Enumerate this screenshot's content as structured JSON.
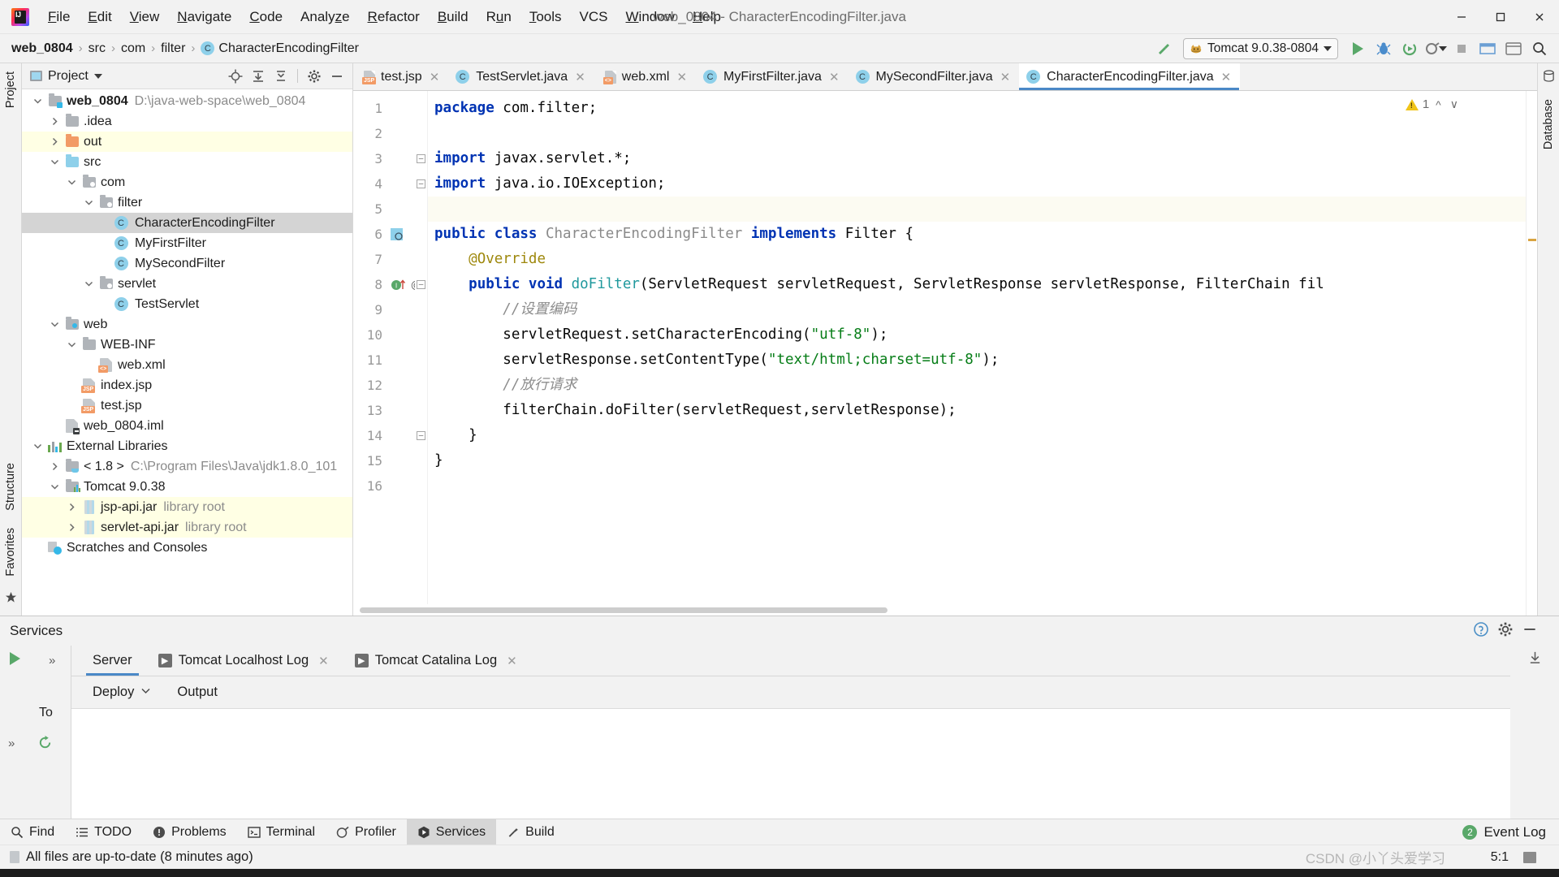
{
  "window": {
    "title": "web_0804 - CharacterEncodingFilter.java",
    "minimize": "─",
    "maximize": "☐",
    "close": "✕"
  },
  "menubar": {
    "items": [
      {
        "label": "File",
        "mnemonic": "F"
      },
      {
        "label": "Edit",
        "mnemonic": "E"
      },
      {
        "label": "View",
        "mnemonic": "V"
      },
      {
        "label": "Navigate",
        "mnemonic": "N"
      },
      {
        "label": "Code",
        "mnemonic": "C"
      },
      {
        "label": "Analyze",
        "mnemonic": "z"
      },
      {
        "label": "Refactor",
        "mnemonic": "R"
      },
      {
        "label": "Build",
        "mnemonic": "B"
      },
      {
        "label": "Run",
        "mnemonic": "u"
      },
      {
        "label": "Tools",
        "mnemonic": "T"
      },
      {
        "label": "VCS",
        "mnemonic": ""
      },
      {
        "label": "Window",
        "mnemonic": "W"
      },
      {
        "label": "Help",
        "mnemonic": "H"
      }
    ]
  },
  "navbar": {
    "breadcrumb": [
      "web_0804",
      "src",
      "com",
      "filter",
      "CharacterEncodingFilter"
    ],
    "class_badge": "C",
    "separator": "›",
    "run_config": "Tomcat 9.0.38-0804",
    "icons": {
      "build": "hammer-icon",
      "run": "run-icon",
      "debug": "debug-icon",
      "coverage": "coverage-icon",
      "profile": "profile-icon",
      "stop": "stop-icon",
      "update": "update-app-icon",
      "browser": "open-browser-icon",
      "search": "search-everywhere-icon"
    }
  },
  "left_strip": {
    "top": [
      "Project"
    ],
    "bottom": [
      "Structure",
      "Favorites"
    ]
  },
  "right_strip": {
    "items": [
      "Database"
    ]
  },
  "project_panel": {
    "title": "Project",
    "tools": [
      "locate-icon",
      "expand-all-icon",
      "collapse-all-icon",
      "gear-icon",
      "hide-icon"
    ],
    "tree": [
      {
        "depth": 0,
        "twist": "down",
        "icon": "module-folder",
        "label": "web_0804",
        "bold": true,
        "sub": "D:\\java-web-space\\web_0804"
      },
      {
        "depth": 1,
        "twist": "right",
        "icon": "folder-grey",
        "label": ".idea",
        "sub": ""
      },
      {
        "depth": 1,
        "twist": "right",
        "icon": "folder-orange",
        "label": "out",
        "sub": "",
        "highlight": "lib"
      },
      {
        "depth": 1,
        "twist": "down",
        "icon": "folder-src",
        "label": "src",
        "sub": ""
      },
      {
        "depth": 2,
        "twist": "down",
        "icon": "folder-pkg",
        "label": "com",
        "sub": ""
      },
      {
        "depth": 3,
        "twist": "down",
        "icon": "folder-pkg",
        "label": "filter",
        "sub": ""
      },
      {
        "depth": 4,
        "twist": "none",
        "icon": "class",
        "label": "CharacterEncodingFilter",
        "sub": "",
        "selected": true
      },
      {
        "depth": 4,
        "twist": "none",
        "icon": "class",
        "label": "MyFirstFilter",
        "sub": ""
      },
      {
        "depth": 4,
        "twist": "none",
        "icon": "class",
        "label": "MySecondFilter",
        "sub": ""
      },
      {
        "depth": 3,
        "twist": "down",
        "icon": "folder-pkg",
        "label": "servlet",
        "sub": ""
      },
      {
        "depth": 4,
        "twist": "none",
        "icon": "class",
        "label": "TestServlet",
        "sub": ""
      },
      {
        "depth": 1,
        "twist": "down",
        "icon": "folder-web",
        "label": "web",
        "sub": ""
      },
      {
        "depth": 2,
        "twist": "down",
        "icon": "folder-grey",
        "label": "WEB-INF",
        "sub": ""
      },
      {
        "depth": 3,
        "twist": "none",
        "icon": "file-xml",
        "label": "web.xml",
        "sub": ""
      },
      {
        "depth": 2,
        "twist": "none",
        "icon": "file-jsp",
        "label": "index.jsp",
        "sub": ""
      },
      {
        "depth": 2,
        "twist": "none",
        "icon": "file-jsp",
        "label": "test.jsp",
        "sub": ""
      },
      {
        "depth": 1,
        "twist": "none",
        "icon": "file-iml",
        "label": "web_0804.iml",
        "sub": ""
      },
      {
        "depth": 0,
        "twist": "down",
        "icon": "libraries",
        "label": "External Libraries",
        "sub": ""
      },
      {
        "depth": 1,
        "twist": "right",
        "icon": "folder-jdk",
        "label": "< 1.8 >",
        "sub": "C:\\Program Files\\Java\\jdk1.8.0_101"
      },
      {
        "depth": 1,
        "twist": "down",
        "icon": "lib-tomcat",
        "label": "Tomcat 9.0.38",
        "sub": ""
      },
      {
        "depth": 2,
        "twist": "right",
        "icon": "jar",
        "label": "jsp-api.jar",
        "sub": "library root",
        "highlight": "lib"
      },
      {
        "depth": 2,
        "twist": "right",
        "icon": "jar",
        "label": "servlet-api.jar",
        "sub": "library root",
        "highlight": "lib"
      },
      {
        "depth": 0,
        "twist": "none",
        "icon": "scratches",
        "label": "Scratches and Consoles",
        "sub": ""
      }
    ]
  },
  "editor": {
    "tabs": [
      {
        "label": "test.jsp",
        "icon": "jsp-file-icon",
        "active": false
      },
      {
        "label": "TestServlet.java",
        "icon": "java-class-icon",
        "active": false
      },
      {
        "label": "web.xml",
        "icon": "xml-file-icon",
        "active": false
      },
      {
        "label": "MyFirstFilter.java",
        "icon": "java-class-icon",
        "active": false
      },
      {
        "label": "MySecondFilter.java",
        "icon": "java-class-icon",
        "active": false
      },
      {
        "label": "CharacterEncodingFilter.java",
        "icon": "java-class-icon",
        "active": true
      }
    ],
    "close_glyph": "✕",
    "inspection_count": "1",
    "line_numbers": [
      "1",
      "2",
      "3",
      "4",
      "5",
      "6",
      "7",
      "8",
      "9",
      "10",
      "11",
      "12",
      "13",
      "14",
      "15",
      "16"
    ],
    "lines": [
      {
        "n": 1,
        "tokens": [
          {
            "t": "kw",
            "v": "package"
          },
          {
            "t": "pln",
            "v": " com.filter;"
          }
        ]
      },
      {
        "n": 2,
        "tokens": []
      },
      {
        "n": 3,
        "tokens": [
          {
            "t": "kw",
            "v": "import"
          },
          {
            "t": "pln",
            "v": " javax.servlet.*;"
          }
        ]
      },
      {
        "n": 4,
        "tokens": [
          {
            "t": "kw",
            "v": "import"
          },
          {
            "t": "pln",
            "v": " java.io.IOException;"
          }
        ]
      },
      {
        "n": 5,
        "tokens": [],
        "highlight": true
      },
      {
        "n": 6,
        "tokens": [
          {
            "t": "kw",
            "v": "public class"
          },
          {
            "t": "cls",
            "v": " CharacterEncodingFilter "
          },
          {
            "t": "kw",
            "v": "implements"
          },
          {
            "t": "pln",
            "v": " Filter {"
          }
        ]
      },
      {
        "n": 7,
        "tokens": [
          {
            "t": "pln",
            "v": "    "
          },
          {
            "t": "ann",
            "v": "@Override"
          }
        ]
      },
      {
        "n": 8,
        "tokens": [
          {
            "t": "pln",
            "v": "    "
          },
          {
            "t": "kw",
            "v": "public void"
          },
          {
            "t": "typ",
            "v": " doFilter"
          },
          {
            "t": "pln",
            "v": "(ServletRequest servletRequest, ServletResponse servletResponse, FilterChain fil"
          }
        ]
      },
      {
        "n": 9,
        "tokens": [
          {
            "t": "pln",
            "v": "        "
          },
          {
            "t": "cmt",
            "v": "//设置编码"
          }
        ]
      },
      {
        "n": 10,
        "tokens": [
          {
            "t": "pln",
            "v": "        servletRequest.setCharacterEncoding("
          },
          {
            "t": "str",
            "v": "\"utf-8\""
          },
          {
            "t": "pln",
            "v": ");"
          }
        ]
      },
      {
        "n": 11,
        "tokens": [
          {
            "t": "pln",
            "v": "        servletResponse.setContentType("
          },
          {
            "t": "str",
            "v": "\"text/html;charset=utf-8\""
          },
          {
            "t": "pln",
            "v": ");"
          }
        ]
      },
      {
        "n": 12,
        "tokens": [
          {
            "t": "pln",
            "v": "        "
          },
          {
            "t": "cmt",
            "v": "//放行请求"
          }
        ]
      },
      {
        "n": 13,
        "tokens": [
          {
            "t": "pln",
            "v": "        filterChain.doFilter(servletRequest,servletResponse);"
          }
        ]
      },
      {
        "n": 14,
        "tokens": [
          {
            "t": "pln",
            "v": "    }"
          }
        ]
      },
      {
        "n": 15,
        "tokens": [
          {
            "t": "pln",
            "v": "}"
          }
        ]
      },
      {
        "n": 16,
        "tokens": []
      }
    ]
  },
  "services": {
    "title": "Services",
    "head_tools": [
      "help-icon",
      "gear-icon",
      "hide-icon"
    ],
    "tabs": [
      {
        "label": "Server",
        "icon": "",
        "active": true,
        "closable": false
      },
      {
        "label": "Tomcat Localhost Log",
        "icon": "log-icon",
        "active": false,
        "closable": true
      },
      {
        "label": "Tomcat Catalina Log",
        "icon": "log-icon",
        "active": false,
        "closable": true
      }
    ],
    "sub_tabs": [
      {
        "label": "Deploy",
        "dropdown": true
      },
      {
        "label": "Output",
        "dropdown": false
      }
    ],
    "tree_node": "To",
    "close_glyph": "✕",
    "expand_glyph": "»"
  },
  "statusbar": {
    "items": [
      {
        "label": "Find",
        "icon": "search-icon",
        "active": false
      },
      {
        "label": "TODO",
        "icon": "todo-icon",
        "active": false
      },
      {
        "label": "Problems",
        "icon": "problems-icon",
        "active": false
      },
      {
        "label": "Terminal",
        "icon": "terminal-icon",
        "active": false
      },
      {
        "label": "Profiler",
        "icon": "profiler-icon",
        "active": false
      },
      {
        "label": "Services",
        "icon": "services-icon",
        "active": true
      },
      {
        "label": "Build",
        "icon": "build-icon",
        "active": false
      }
    ],
    "event_log": {
      "label": "Event Log",
      "count": "2"
    },
    "message": "All files are up-to-date (8 minutes ago)",
    "watermark": "CSDN @小丫头爱学习",
    "caret": "5:1"
  },
  "colors": {
    "accent": "#4a88c7",
    "keyword": "#0033b3",
    "string": "#067d17",
    "comment": "#8c8c8c",
    "annotation": "#9e880d",
    "type": "#20999d",
    "selection": "#d4d4d4",
    "library_row": "#ffffe4",
    "run_green": "#59a869",
    "warning": "#f0c419"
  }
}
